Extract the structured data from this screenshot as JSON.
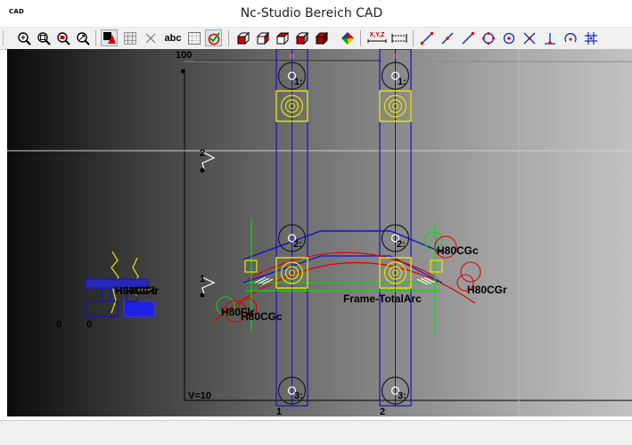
{
  "window": {
    "app_icon_label": "CAD",
    "title": "Nc-Studio Bereich CAD"
  },
  "toolbar": {
    "buttons": [
      "zoom-in-icon",
      "zoom-window-icon",
      "zoom-out-icon",
      "zoom-all-icon",
      "layer-fill-icon",
      "grid-icon",
      "cross-hair-icon",
      "text-tool-icon",
      "check-marker-icon",
      "box-view-front-icon",
      "box-view-side-icon",
      "box-view-top-icon",
      "box-view-iso-icon",
      "box-view-shaded-icon",
      "color-palette-icon",
      "coordinate-xyz-icon",
      "dimension-icon",
      "line-two-point-icon",
      "line-icon",
      "line-point-icon",
      "circle-tangent-icon",
      "circle-center-icon",
      "intersection-icon",
      "perpendicular-icon",
      "arc-icon",
      "crosshair-grid-icon"
    ],
    "text_button": "abc",
    "xyz_button": "X,Y,Z"
  },
  "canvas": {
    "scale_top": "100",
    "level_2": "2",
    "level_1": "1",
    "column_1": "1",
    "column_2": "2",
    "view_label": "V=10",
    "origin_x": "0",
    "origin_y": "0",
    "node_1a": "1:",
    "node_1b": "1:",
    "node_2a": "2:",
    "node_2b": "2:",
    "node_3a": "3:",
    "node_3b": "3:",
    "label_h80cgc_top": "H80CGc",
    "label_h80cgr": "H80CGr",
    "label_frame": "Frame-TotalArc",
    "label_h80cgc_left": "H80CGc",
    "label_h80flr_left": "H80Flr",
    "label_h80flr_legend": "H80Flr",
    "label_h80cgc_legend": "H80CGc"
  },
  "colors": {
    "structure_blue": "#1010d0",
    "bracket_yellow": "#e8e800",
    "axis_green": "#00e000",
    "arc_red": "#e00000",
    "node_white": "#ffffff"
  }
}
